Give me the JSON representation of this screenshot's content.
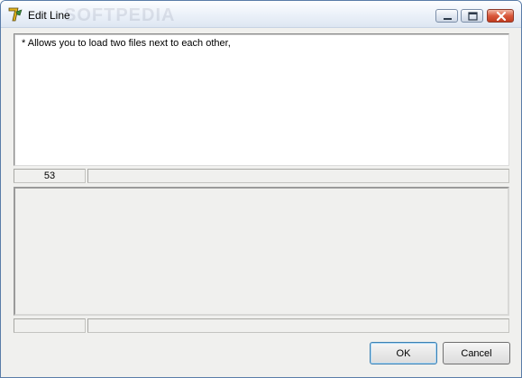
{
  "window": {
    "title": "Edit Line",
    "watermark": "SOFTPEDIA",
    "icons": {
      "app": "app-logo-icon",
      "minimize": "minimize-icon",
      "maximize": "maximize-icon",
      "close": "close-icon"
    },
    "colors": {
      "close_button": "#c03c20",
      "ok_focus_border": "#3c7fb1"
    }
  },
  "editor": {
    "text": "* Allows you to load two files next to each other,"
  },
  "status_top": {
    "count": "53",
    "info": ""
  },
  "status_bottom": {
    "count": "",
    "info": ""
  },
  "buttons": {
    "ok": "OK",
    "cancel": "Cancel"
  }
}
